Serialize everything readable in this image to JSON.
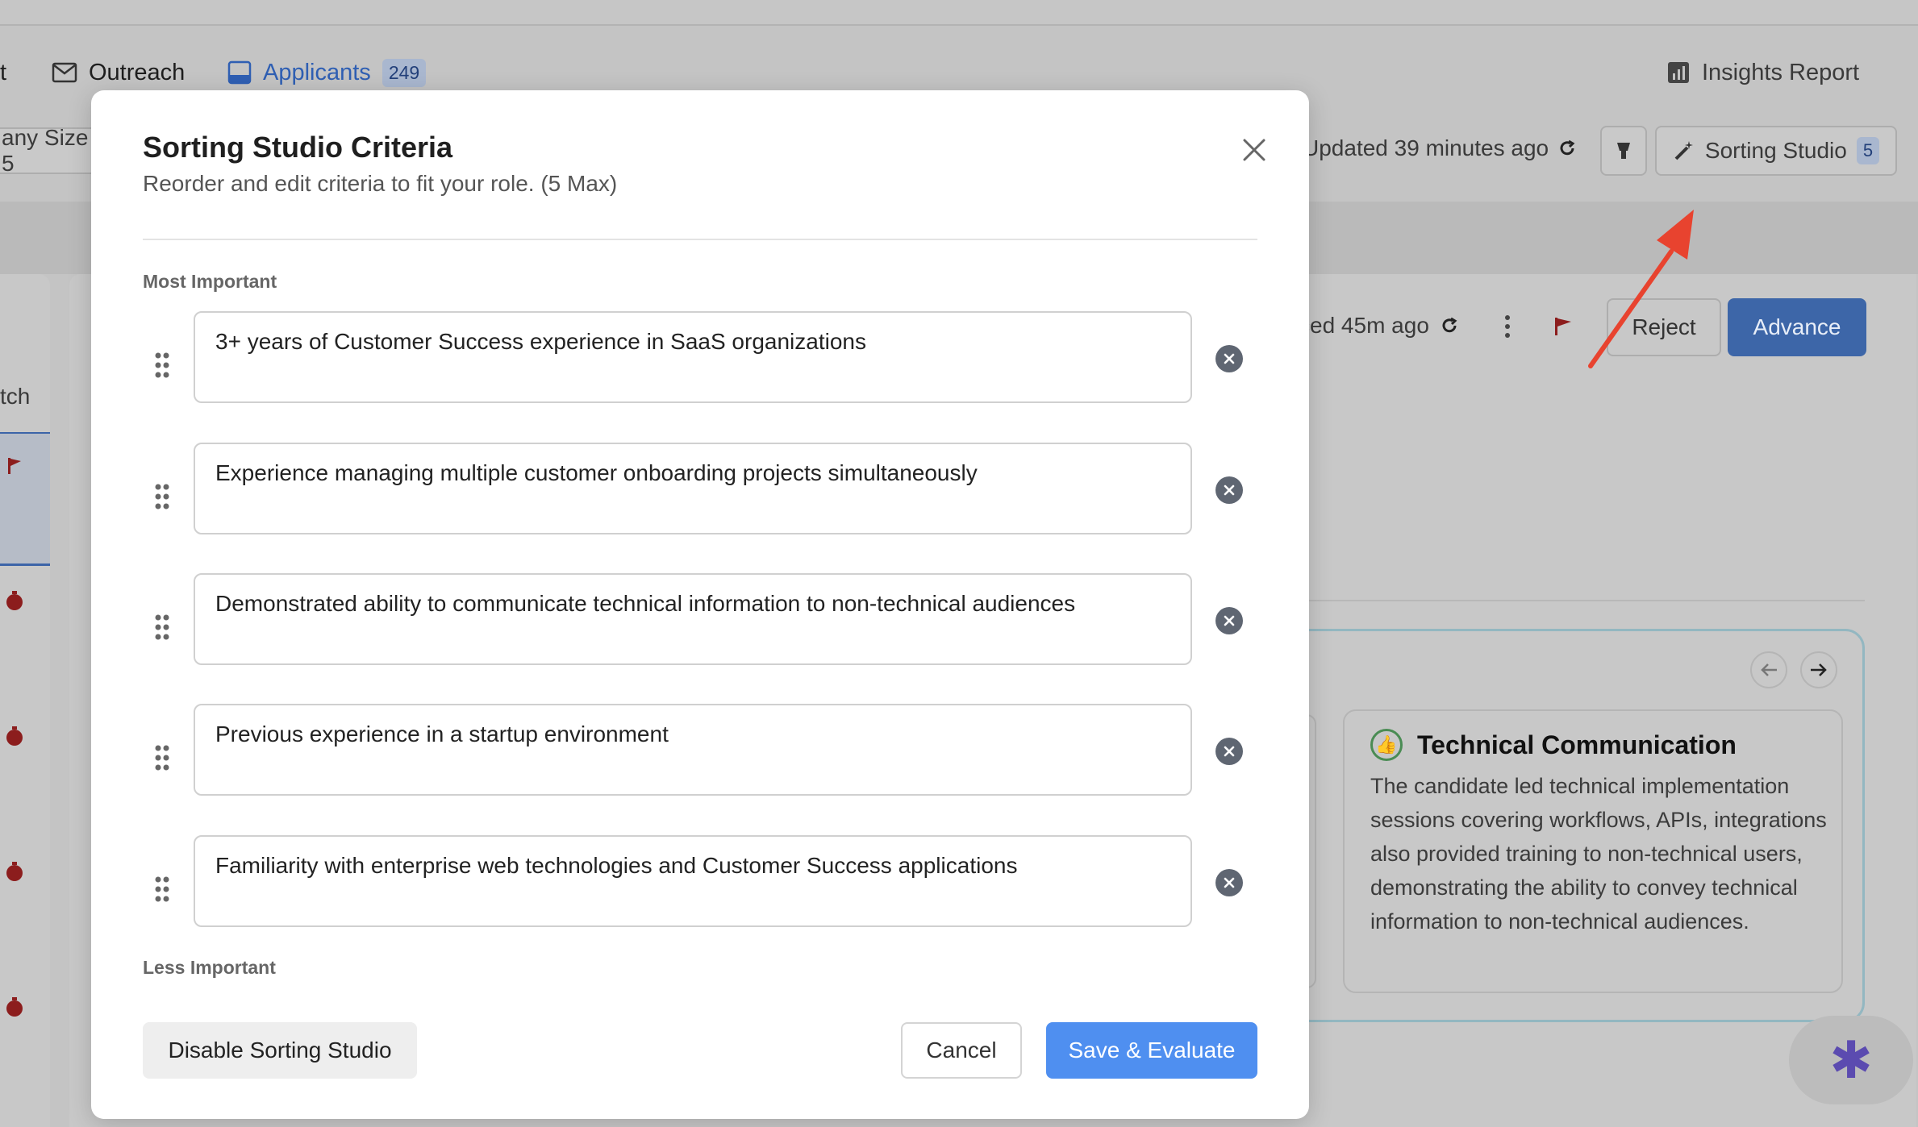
{
  "background": {
    "nav": {
      "cut_left": "t",
      "outreach": "Outreach",
      "applicants": "Applicants",
      "applicants_count": "249",
      "insights": "Insights Report"
    },
    "toolbar": {
      "company_size_cut": "any Size 5",
      "updated": "Updated 39 minutes ago",
      "sorting_studio": "Sorting Studio",
      "sorting_studio_count": "5"
    },
    "detail": {
      "synced": "ced 45m ago",
      "reject": "Reject",
      "advance": "Advance",
      "left_tab_cut": "tch"
    },
    "card": {
      "title": "Technical Communication",
      "body_lines": [
        "The candidate led technical implementation",
        "sessions covering workflows, APIs, integrations",
        "also provided training to non-technical users,",
        "demonstrating the ability to convey technical",
        "information to non-technical audiences."
      ]
    }
  },
  "modal": {
    "title": "Sorting Studio Criteria",
    "subtitle": "Reorder and edit criteria to fit your role. (5 Max)",
    "most_important_label": "Most Important",
    "less_important_label": "Less Important",
    "criteria": [
      "3+ years of Customer Success experience in SaaS organizations",
      "Experience managing multiple customer onboarding projects simultaneously",
      "Demonstrated ability to communicate technical information to non-technical audiences",
      "Previous experience in a startup environment",
      "Familiarity with enterprise web technologies and Customer Success applications"
    ],
    "buttons": {
      "disable": "Disable Sorting Studio",
      "cancel": "Cancel",
      "save": "Save & Evaluate"
    }
  },
  "colors": {
    "accent_blue": "#4f8ff0",
    "annotation_arrow": "#e8432f",
    "remove_icon": "#5f6672"
  }
}
